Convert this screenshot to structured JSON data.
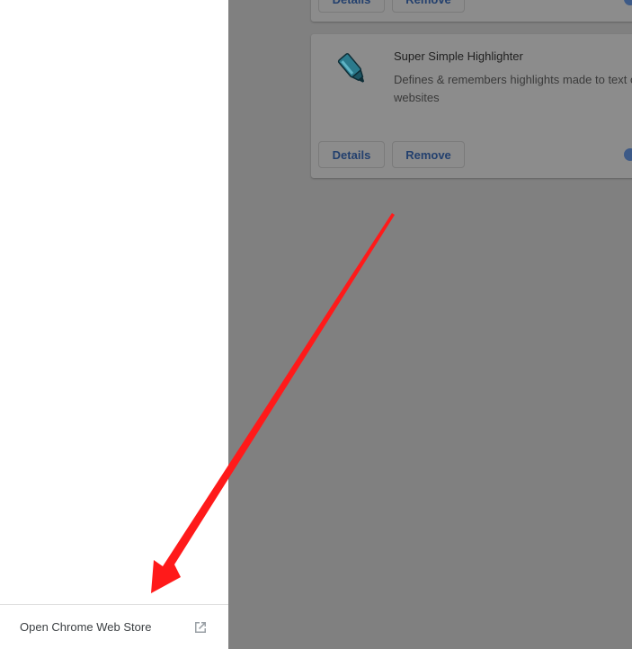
{
  "drawer": {
    "footer_link": "Open Chrome Web Store",
    "footer_icon": "open-in-new-icon"
  },
  "extensions": {
    "top_card": {
      "details_label": "Details",
      "remove_label": "Remove"
    },
    "main_card": {
      "name": "Super Simple Highlighter",
      "description": "Defines & remembers highlights made to text on websites",
      "icon": "highlighter-marker-icon",
      "details_label": "Details",
      "remove_label": "Remove"
    }
  },
  "annotation": {
    "arrow_color": "#ff1a1a",
    "arrow_icon": "red-arrow"
  },
  "colors": {
    "overlay": "#808080",
    "button_text": "#23406e",
    "toggle": "#3d5a87"
  }
}
